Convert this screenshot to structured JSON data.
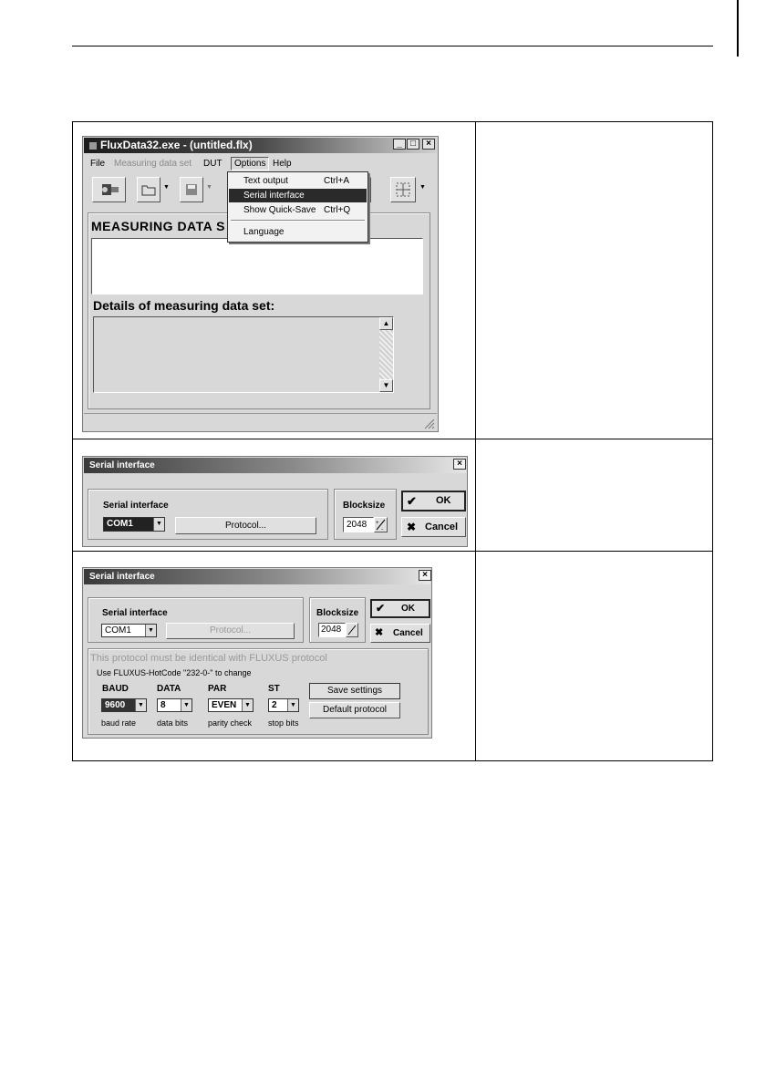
{
  "shot1": {
    "title": "FluxData32.exe - (untitled.flx)",
    "window_buttons": [
      "_",
      "□",
      "×"
    ],
    "menu": [
      "File",
      "Measuring data set",
      "DUT",
      "Options",
      "Help"
    ],
    "dropdown": [
      {
        "label": "Text output",
        "shortcut": "Ctrl+A"
      },
      {
        "label": "Serial interface",
        "shortcut": ""
      },
      {
        "label": "Show Quick-Save",
        "shortcut": "Ctrl+Q"
      },
      {
        "label": "Language",
        "shortcut": ""
      }
    ],
    "heading_visible": "MEASURING DATA S",
    "details_label": "Details of measuring data set:"
  },
  "shot2": {
    "title": "Serial interface",
    "serial_label": "Serial interface",
    "com_value": "COM1",
    "protocol_label": "Protocol...",
    "blocksize_label": "Blocksize",
    "blocksize_value": "2048",
    "ok_label": "OK",
    "cancel_label": "Cancel"
  },
  "shot3": {
    "title": "Serial interface",
    "serial_label": "Serial interface",
    "com_value": "COM1",
    "protocol_label": "Protocol...",
    "blocksize_label": "Blocksize",
    "blocksize_value": "2048",
    "ok_label": "OK",
    "cancel_label": "Cancel",
    "note_line1": "This protocol must be identical with FLUXUS protocol",
    "note_line2": "Use FLUXUS-HotCode \"232-0-\" to change",
    "fields": [
      {
        "header": "BAUD",
        "value": "9600",
        "caption": "baud rate"
      },
      {
        "header": "DATA",
        "value": "8",
        "caption": "data bits"
      },
      {
        "header": "PAR",
        "value": "EVEN",
        "caption": "parity check"
      },
      {
        "header": "ST",
        "value": "2",
        "caption": "stop bits"
      }
    ],
    "save_label": "Save settings",
    "default_label": "Default protocol"
  },
  "icons": [
    "app-icon",
    "connect-icon",
    "open-folder-icon",
    "save-disk-icon",
    "grid-icon",
    "scroll-up-icon",
    "scroll-down-icon",
    "resize-grip-icon",
    "checkmark-icon",
    "cross-icon",
    "spin-icon"
  ]
}
